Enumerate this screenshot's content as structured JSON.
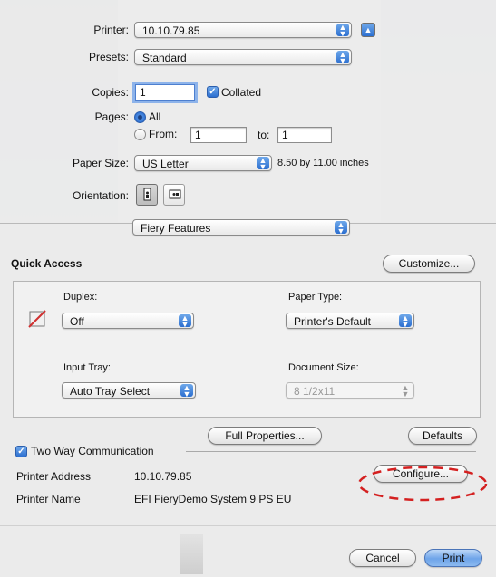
{
  "printer": {
    "label": "Printer:",
    "value": "10.10.79.85"
  },
  "presets": {
    "label": "Presets:",
    "value": "Standard"
  },
  "copies": {
    "label": "Copies:",
    "value": "1",
    "collated_label": "Collated",
    "collated": true
  },
  "pages": {
    "label": "Pages:",
    "all_label": "All",
    "from_label": "From:",
    "from_value": "1",
    "to_label": "to:",
    "to_value": "1",
    "selected": "All"
  },
  "paper_size": {
    "label": "Paper Size:",
    "value": "US Letter",
    "dimensions": "8.50 by 11.00 inches"
  },
  "orientation": {
    "label": "Orientation:",
    "selected": "portrait"
  },
  "section_popup": {
    "value": "Fiery Features"
  },
  "quick_access": {
    "title": "Quick Access",
    "customize_label": "Customize...",
    "duplex": {
      "label": "Duplex:",
      "value": "Off"
    },
    "paper_type": {
      "label": "Paper Type:",
      "value": "Printer's Default"
    },
    "input_tray": {
      "label": "Input Tray:",
      "value": "Auto Tray Select"
    },
    "document_size": {
      "label": "Document Size:",
      "value": "8 1/2x11"
    }
  },
  "full_properties_label": "Full Properties...",
  "defaults_label": "Defaults",
  "two_way": {
    "label": "Two Way Communication",
    "checked": true
  },
  "printer_address": {
    "label": "Printer Address",
    "value": "10.10.79.85"
  },
  "printer_name": {
    "label": "Printer Name",
    "value": "EFI FieryDemo System 9 PS EU"
  },
  "configure_label": "Configure...",
  "cancel_label": "Cancel",
  "print_label": "Print",
  "colors": {
    "accent": "#2c6fd0",
    "highlight_circle": "#d42020"
  }
}
